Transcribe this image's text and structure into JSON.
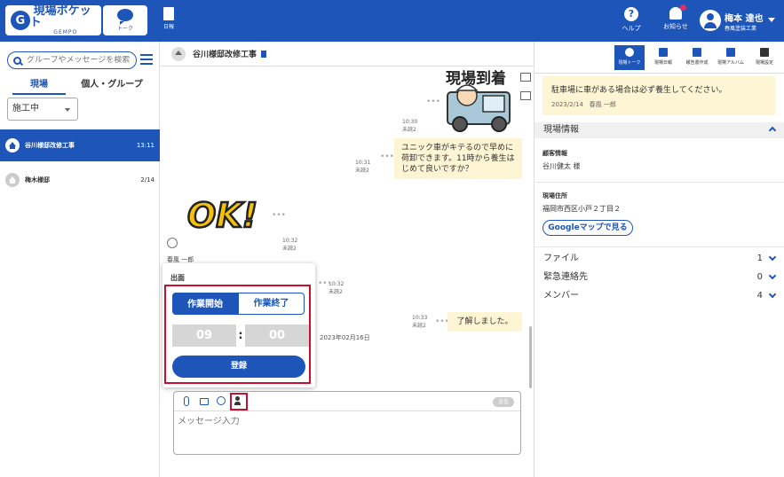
{
  "app": {
    "logo_text": "現場ポケット",
    "logo_sub": "GEMPO",
    "talk_label": "トーク",
    "nippo_label": "日報",
    "help_label": "ヘルプ",
    "notice_label": "お知らせ",
    "user_name": "梅本 達也",
    "user_company": "春風塗装工業"
  },
  "sidebar": {
    "search_placeholder": "グループやメッセージを検索",
    "tab_genba": "現場",
    "tab_kojin": "個人・グループ",
    "status_filter": "施工中",
    "items": [
      {
        "name": "谷川様邸改修工事",
        "time": "13:11"
      },
      {
        "name": "梅木様邸",
        "time": "2/14"
      }
    ]
  },
  "chat": {
    "title": "谷川様邸改修工事",
    "stamp_arrival_text": "現場到着",
    "stamp_ok_text": "OK!",
    "messages": [
      {
        "time": "10:30",
        "read": "未読2",
        "text": ""
      },
      {
        "time": "10:31",
        "read": "未読2",
        "text": "ユニック車がキテるので早めに荷卸できます。11時から養生はじめて良いですか？"
      },
      {
        "time": "10:32",
        "read": "未読2",
        "text": ""
      },
      {
        "time": "10:32",
        "read": "未読2",
        "text": ""
      },
      {
        "time": "10:33",
        "read": "未読2",
        "text": "了解しました。"
      }
    ],
    "sender_name": "春風 一郎",
    "date_label": "2023年02月16日",
    "input_placeholder": "メッセージ入力",
    "send_label": "送信"
  },
  "popup": {
    "title": "出面",
    "start_label": "作業開始",
    "end_label": "作業終了",
    "hour": "09",
    "minute": "00",
    "register_label": "登録"
  },
  "right_panel": {
    "tabs": [
      "現場トーク",
      "現場日報",
      "報告書作成",
      "現場アルバム",
      "現場設定"
    ],
    "notice_text": "駐車場に車がある場合は必ず養生してください。",
    "notice_date": "2023/2/14",
    "notice_author": "春風 一郎",
    "section_title": "現場情報",
    "customer_label": "顧客情報",
    "customer_value": "谷川健太 様",
    "address_label": "現場住所",
    "address_value": "福岡市西区小戸２丁目２",
    "gmap_label": "Googleマップで見る",
    "rows": [
      {
        "name": "ファイル",
        "count": "1"
      },
      {
        "name": "緊急連絡先",
        "count": "0"
      },
      {
        "name": "メンバー",
        "count": "4"
      }
    ]
  }
}
